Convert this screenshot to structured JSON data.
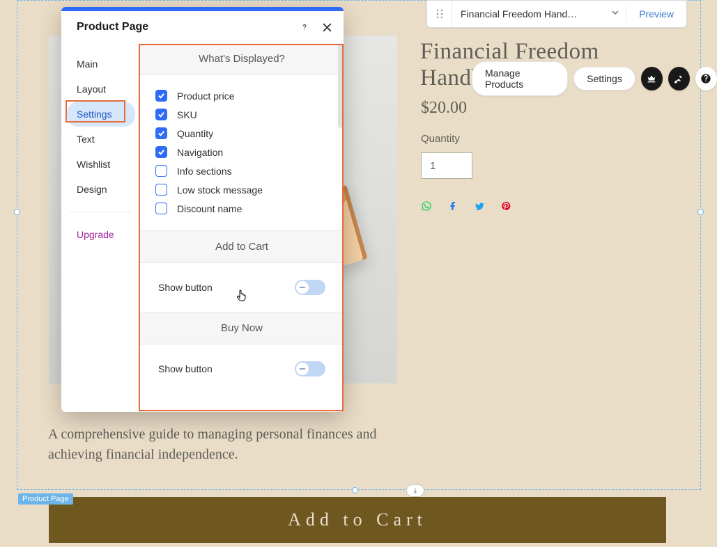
{
  "topbar": {
    "dropdown_label": "Financial Freedom Hand…",
    "preview_label": "Preview"
  },
  "action_pills": {
    "manage_products": "Manage Products",
    "settings": "Settings"
  },
  "product": {
    "title": "Financial Freedom Handbook",
    "price": "$20.00",
    "quantity_label": "Quantity",
    "quantity_value": "1",
    "description": "A comprehensive guide to managing personal finances and achieving financial independence.",
    "add_to_cart_label": "Add to Cart"
  },
  "selection": {
    "tag": "Product Page",
    "anchor_glyph": "⤓"
  },
  "panel": {
    "title": "Product Page",
    "nav": {
      "main": "Main",
      "layout": "Layout",
      "settings": "Settings",
      "text": "Text",
      "wishlist": "Wishlist",
      "design": "Design",
      "upgrade": "Upgrade"
    },
    "sections": {
      "whats_displayed": "What's Displayed?",
      "add_to_cart": "Add to Cart",
      "buy_now": "Buy Now"
    },
    "checks": {
      "product_price": "Product price",
      "sku": "SKU",
      "quantity": "Quantity",
      "navigation": "Navigation",
      "info_sections": "Info sections",
      "low_stock": "Low stock message",
      "discount_name": "Discount name"
    },
    "toggle_label": "Show button"
  }
}
